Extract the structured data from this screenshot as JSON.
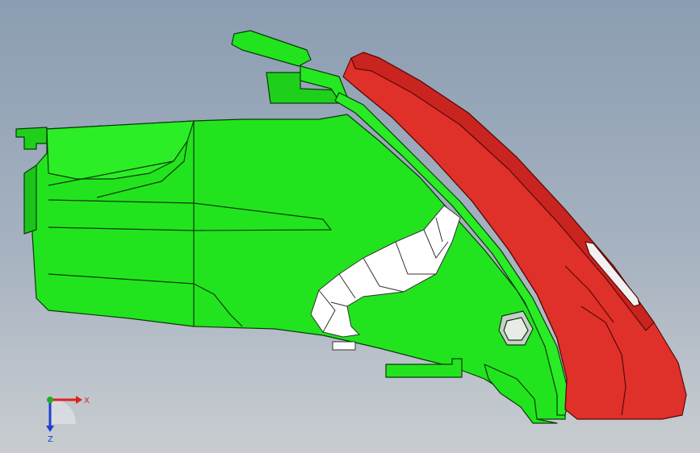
{
  "triad": {
    "x_label": "X",
    "z_label": "Z"
  },
  "colors": {
    "green_body": "#22e41e",
    "green_dark": "#1aa516",
    "red_lens": "#e0302a",
    "red_dark": "#b51c16",
    "edge": "#0a3a08",
    "bracket_white": "#ffffff",
    "axis_x": "#e02020",
    "axis_y": "#20b020",
    "axis_z": "#2040d0"
  }
}
